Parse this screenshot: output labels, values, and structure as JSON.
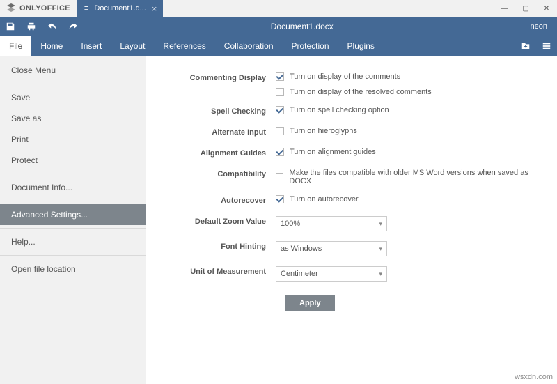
{
  "titlebar": {
    "brand": "ONLYOFFICE",
    "tab_label": "Document1.d...",
    "win": {
      "min": "—",
      "max": "▢",
      "close": "✕"
    }
  },
  "toolbar": {
    "doc_title": "Document1.docx",
    "user": "neon"
  },
  "menubar": {
    "items": [
      {
        "label": "File"
      },
      {
        "label": "Home"
      },
      {
        "label": "Insert"
      },
      {
        "label": "Layout"
      },
      {
        "label": "References"
      },
      {
        "label": "Collaboration"
      },
      {
        "label": "Protection"
      },
      {
        "label": "Plugins"
      }
    ]
  },
  "sidebar": {
    "items": [
      {
        "label": "Close Menu"
      },
      {
        "label": "Save"
      },
      {
        "label": "Save as"
      },
      {
        "label": "Print"
      },
      {
        "label": "Protect"
      },
      {
        "label": "Document Info..."
      },
      {
        "label": "Advanced Settings..."
      },
      {
        "label": "Help..."
      },
      {
        "label": "Open file location"
      }
    ]
  },
  "settings": {
    "commenting_display": {
      "label": "Commenting Display",
      "opt1": "Turn on display of the comments",
      "opt2": "Turn on display of the resolved comments",
      "c1": true,
      "c2": false
    },
    "spell_checking": {
      "label": "Spell Checking",
      "opt": "Turn on spell checking option",
      "c": true
    },
    "alternate_input": {
      "label": "Alternate Input",
      "opt": "Turn on hieroglyphs",
      "c": false
    },
    "alignment_guides": {
      "label": "Alignment Guides",
      "opt": "Turn on alignment guides",
      "c": true
    },
    "compatibility": {
      "label": "Compatibility",
      "opt": "Make the files compatible with older MS Word versions when saved as DOCX",
      "c": false
    },
    "autorecover": {
      "label": "Autorecover",
      "opt": "Turn on autorecover",
      "c": true
    },
    "default_zoom": {
      "label": "Default Zoom Value",
      "value": "100%"
    },
    "font_hinting": {
      "label": "Font Hinting",
      "value": "as Windows"
    },
    "unit": {
      "label": "Unit of Measurement",
      "value": "Centimeter"
    },
    "apply": "Apply"
  },
  "watermark": "wsxdn.com"
}
